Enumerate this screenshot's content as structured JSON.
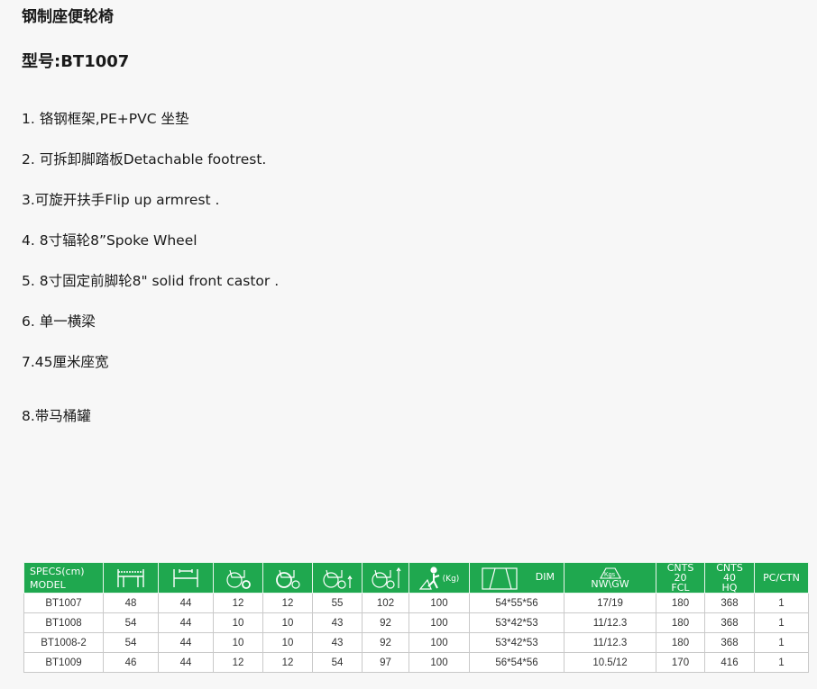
{
  "title": "钢制座便轮椅",
  "model_label": "型号:BT1007",
  "features": [
    "1. 铬钢框架,PE+PVC 坐垫",
    "2. 可拆卸脚踏板Detachable footrest.",
    "3.可旋开扶手Flip up armrest .",
    "4. 8寸辐轮8”Spoke Wheel",
    "5. 8寸固定前脚轮8\" solid front castor .",
    "6. 单一横梁",
    "7.45厘米座宽",
    "8.带马桶罐"
  ],
  "table": {
    "header": {
      "specs": "SPECS(cm)",
      "model": "MODEL",
      "kg": "(Kg)",
      "dim": "DIM",
      "kgs": "Kgs",
      "nwgw": "NW\\GW",
      "cnts20": [
        "CNTS",
        "20",
        "FCL"
      ],
      "cnts40": [
        "CNTS",
        "40",
        "HQ"
      ],
      "pcctn": "PC/CTN"
    },
    "icons": [
      "overall-width-icon",
      "seat-width-icon",
      "front-wheel-icon",
      "rear-wheel-icon",
      "seat-height-icon",
      "overall-height-icon",
      "max-weight-icon",
      "carton-dim-icon",
      "weight-scale-icon"
    ],
    "rows": [
      [
        "BT1007",
        "48",
        "44",
        "12",
        "12",
        "55",
        "102",
        "100",
        "54*55*56",
        "17/19",
        "180",
        "368",
        "1"
      ],
      [
        "BT1008",
        "54",
        "44",
        "10",
        "10",
        "43",
        "92",
        "100",
        "53*42*53",
        "11/12.3",
        "180",
        "368",
        "1"
      ],
      [
        "BT1008-2",
        "54",
        "44",
        "10",
        "10",
        "43",
        "92",
        "100",
        "53*42*53",
        "11/12.3",
        "180",
        "368",
        "1"
      ],
      [
        "BT1009",
        "46",
        "44",
        "12",
        "12",
        "54",
        "97",
        "100",
        "56*54*56",
        "10.5/12",
        "170",
        "416",
        "1"
      ]
    ]
  }
}
